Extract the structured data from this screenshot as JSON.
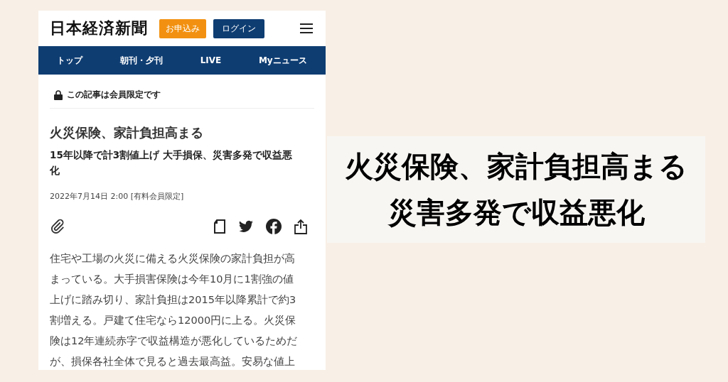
{
  "header": {
    "logo": "日本経済新聞",
    "buttons": [
      {
        "label": "お申込み",
        "kind": "signup"
      },
      {
        "label": "ログイン",
        "kind": "login"
      }
    ]
  },
  "nav": [
    {
      "label": "トップ"
    },
    {
      "label": "朝刊・夕刊"
    },
    {
      "label": "LIVE"
    },
    {
      "label": "Myニュース"
    }
  ],
  "notice": "この記事は会員限定です",
  "article": {
    "title": "火災保険、家計負担高まる",
    "subtitle": "15年以降で計3割値上げ 大手損保、災害多発で収益悪化",
    "date": "2022年7月14日 2:00 [有料会員限定]",
    "body": "住宅や工場の火災に備える火災保険の家計負担が高まっている。大手損害保険は今年10月に1割強の値上げに踏み切り、家計負担は2015年以降累計で約3割増える。戸建て住宅なら12000円に上る。火災保険は12年連続赤字で収益構造が悪化しているためだが、損保各社全体で見ると過去最高益。安易な値上"
  },
  "caption": {
    "lines": [
      "火災保険、家計負担高まる",
      "災害多発で収益悪化"
    ]
  }
}
